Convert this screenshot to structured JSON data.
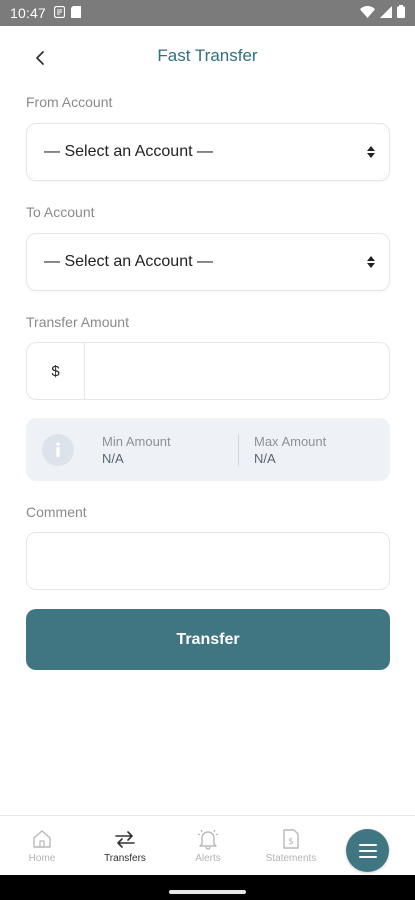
{
  "status_bar": {
    "time": "10:47"
  },
  "header": {
    "title": "Fast Transfer",
    "back_icon": "chevron-left-icon"
  },
  "from_account": {
    "label": "From Account",
    "selected": "— Select an Account —"
  },
  "to_account": {
    "label": "To Account",
    "selected": "— Select an Account —"
  },
  "transfer_amount": {
    "label": "Transfer Amount",
    "currency_symbol": "$",
    "value": ""
  },
  "limits": {
    "min_label": "Min Amount",
    "min_value": "N/A",
    "max_label": "Max Amount",
    "max_value": "N/A"
  },
  "comment": {
    "label": "Comment",
    "value": ""
  },
  "transfer_button": {
    "label": "Transfer"
  },
  "bottom_nav": {
    "items": [
      {
        "label": "Home",
        "icon": "home-icon",
        "active": false
      },
      {
        "label": "Transfers",
        "icon": "transfer-arrows-icon",
        "active": true
      },
      {
        "label": "Alerts",
        "icon": "bell-icon",
        "active": false
      },
      {
        "label": "Statements",
        "icon": "document-dollar-icon",
        "active": false
      }
    ],
    "menu_icon": "hamburger-menu-icon"
  },
  "colors": {
    "accent": "#3f7682",
    "title": "#2f6f7e",
    "info_bg": "#eef2f7"
  }
}
